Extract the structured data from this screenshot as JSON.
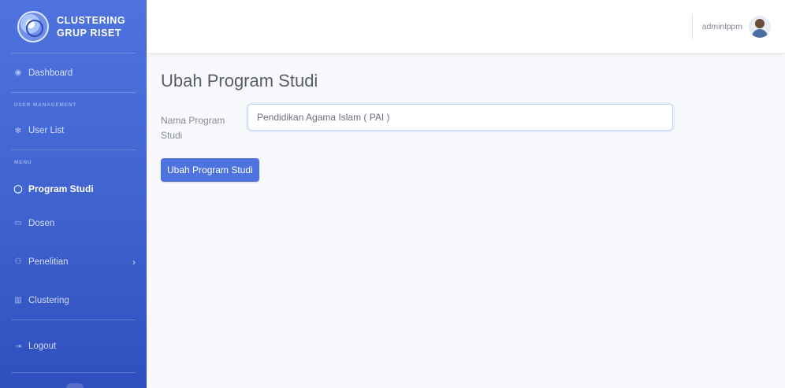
{
  "brand": {
    "line1": "CLUSTERING",
    "line2": "GRUP RISET"
  },
  "sidebar": {
    "dashboard": "Dashboard",
    "section_user": "USER MANAGEMENT",
    "user_list": "User List",
    "section_menu": "MENU",
    "program_studi": "Program Studi",
    "dosen": "Dosen",
    "penelitian": "Penelitian",
    "clustering": "Clustering",
    "logout": "Logout"
  },
  "topbar": {
    "username": "adminlppm"
  },
  "main": {
    "title": "Ubah Program Studi",
    "label": "Nama Program Studi",
    "input_value": "Pendidikan Agama Islam ( PAI )",
    "submit_label": "Ubah Program Studi"
  },
  "colors": {
    "primary": "#4e73df",
    "sidebar_dark": "#2f4fbf",
    "text_muted": "#858796"
  }
}
